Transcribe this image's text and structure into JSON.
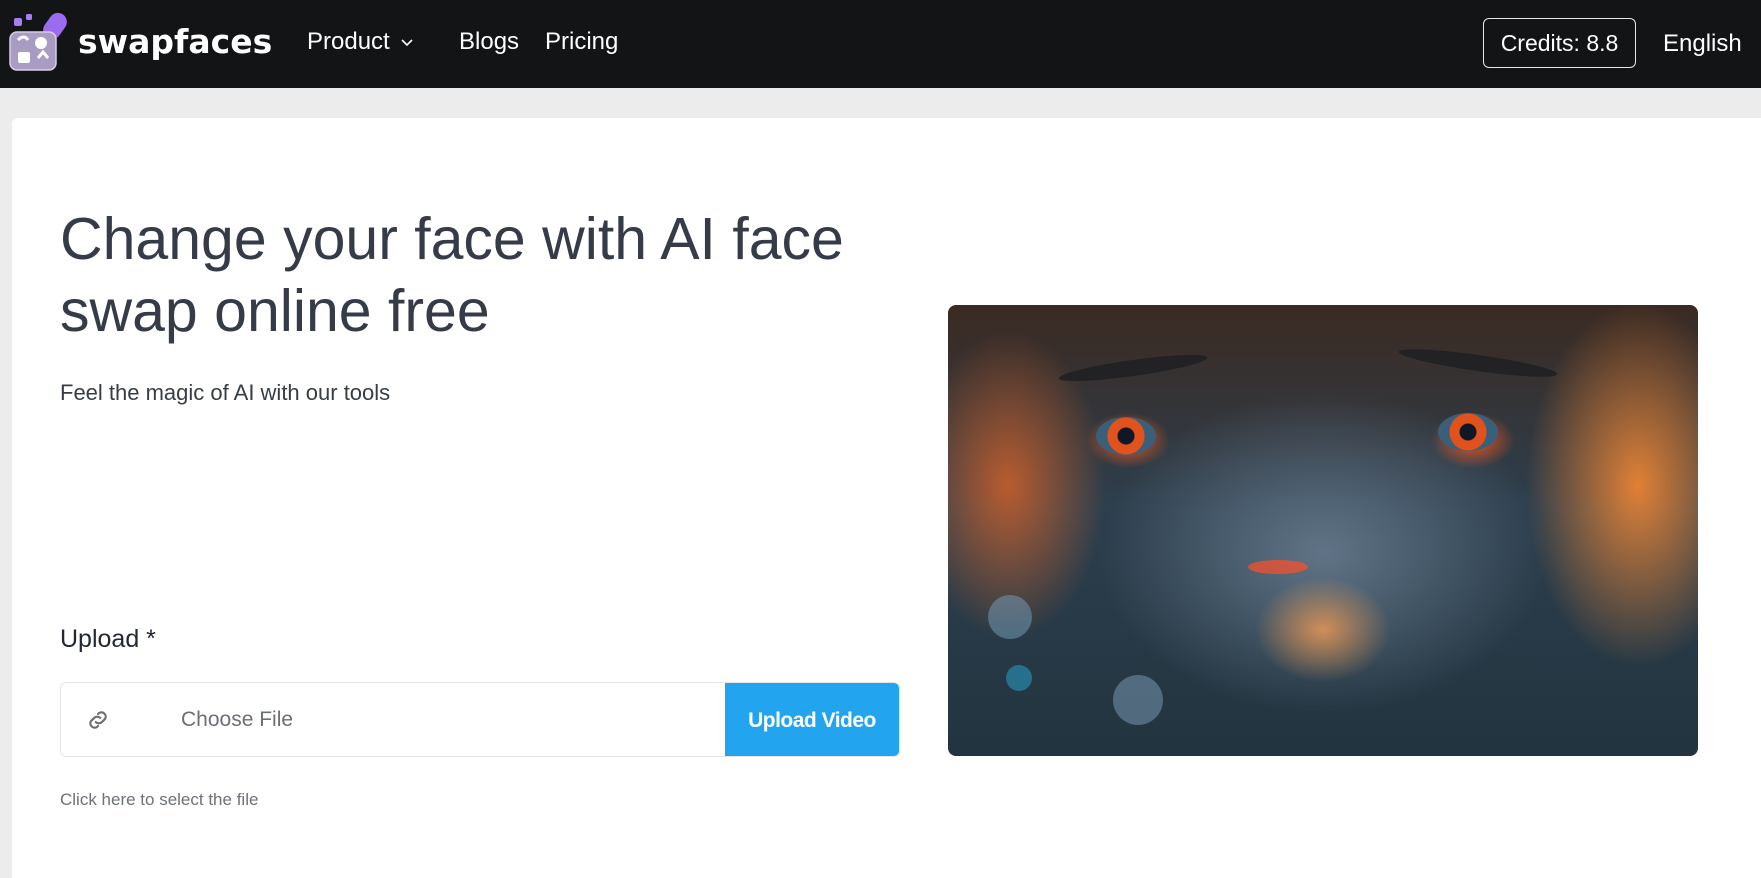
{
  "header": {
    "brand": "swapfaces",
    "nav": [
      {
        "label": "Product",
        "has_dropdown": true
      },
      {
        "label": "Blogs"
      },
      {
        "label": "Pricing"
      }
    ],
    "credits_label": "Credits: 8.8",
    "language": "English"
  },
  "hero": {
    "title": "Change your face with AI face swap online free",
    "subtitle": "Feel the magic of AI with our tools",
    "image_alt": "AI-generated face with glowing orange particles"
  },
  "upload": {
    "label": "Upload *",
    "choose_file": "Choose File",
    "button_label": "Upload Video",
    "helper_text": "Click here to select the file"
  },
  "colors": {
    "header_bg": "#131416",
    "accent": "#22a5ee",
    "page_bg": "#ececec",
    "title_text": "#353b47",
    "logo_purple": "#9b6cf0"
  }
}
